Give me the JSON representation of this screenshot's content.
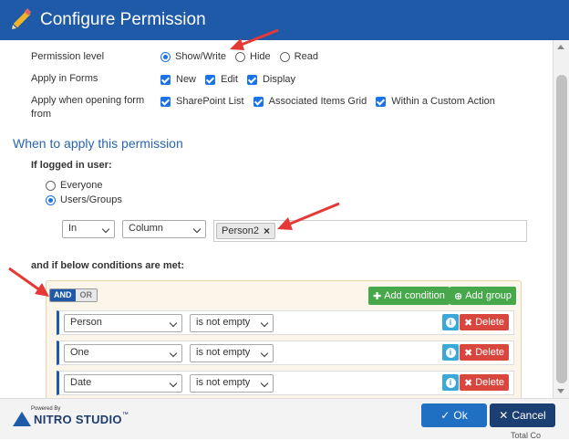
{
  "dialog": {
    "title": "Configure Permission",
    "permission_level": {
      "label": "Permission level",
      "options": [
        "Show/Write",
        "Hide",
        "Read"
      ],
      "selected": "Show/Write"
    },
    "apply_in_forms": {
      "label": "Apply in Forms",
      "options": [
        "New",
        "Edit",
        "Display"
      ]
    },
    "apply_when_opening": {
      "label_line1": "Apply when opening form",
      "label_line2": "from",
      "options": [
        "SharePoint List",
        "Associated Items Grid",
        "Within a Custom Action"
      ]
    },
    "section_title": "When to apply this permission",
    "logged_in": {
      "label": "If logged in user:",
      "options": [
        "Everyone",
        "Users/Groups"
      ],
      "selected": "Users/Groups"
    },
    "user_filter": {
      "operator": "In",
      "source": "Column",
      "tag": "Person2",
      "tag_remove": "×"
    },
    "conditions_label": "and if below conditions are met:",
    "logic": {
      "and": "AND",
      "or": "OR",
      "selected": "AND"
    },
    "add_condition": "Add condition",
    "add_group": "Add group",
    "conditions": [
      {
        "field": "Person",
        "operator": "is not empty",
        "delete": "Delete"
      },
      {
        "field": "One",
        "operator": "is not empty",
        "delete": "Delete"
      },
      {
        "field": "Date",
        "operator": "is not empty",
        "delete": "Delete"
      }
    ]
  },
  "footer": {
    "powered_by": "Powered By",
    "brand": "NITRO STUDIO",
    "tm": "™",
    "ok": "Ok",
    "cancel": "Cancel"
  },
  "background_text": "Total Co",
  "colors": {
    "title_bar": "#1f5aa8",
    "accent": "#1a73e8",
    "green": "#46a84a",
    "delete_red": "#d9463e",
    "annotation_arrow": "#e53935"
  }
}
